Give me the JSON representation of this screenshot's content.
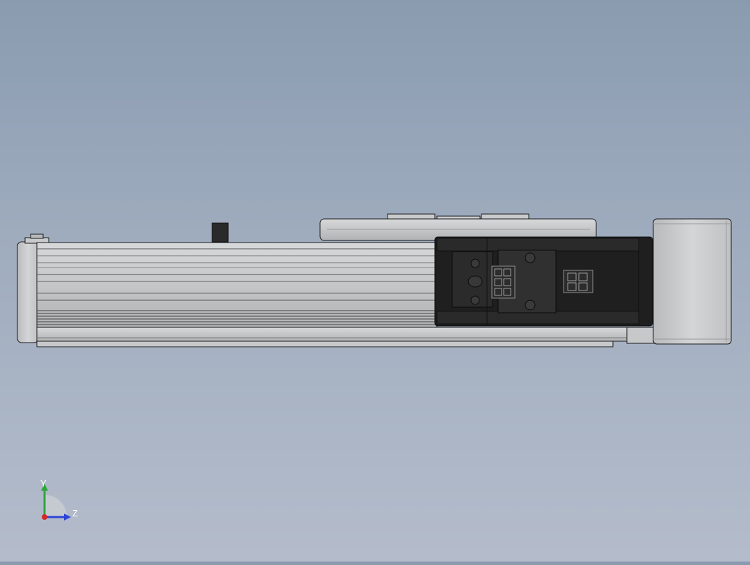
{
  "triad": {
    "y_label": "Y",
    "z_label": "Z",
    "y_color": "#2fa53a",
    "z_color": "#2d44d8",
    "origin_color": "#d42a2a"
  },
  "colors": {
    "background_top": "#8a9bb0",
    "background_bottom": "#b4bccb",
    "aluminum": "#c9cbcd",
    "aluminum_dark": "#9a9c9e",
    "motor_block": "#1f1f1f",
    "outline": "#1a1a1a"
  }
}
